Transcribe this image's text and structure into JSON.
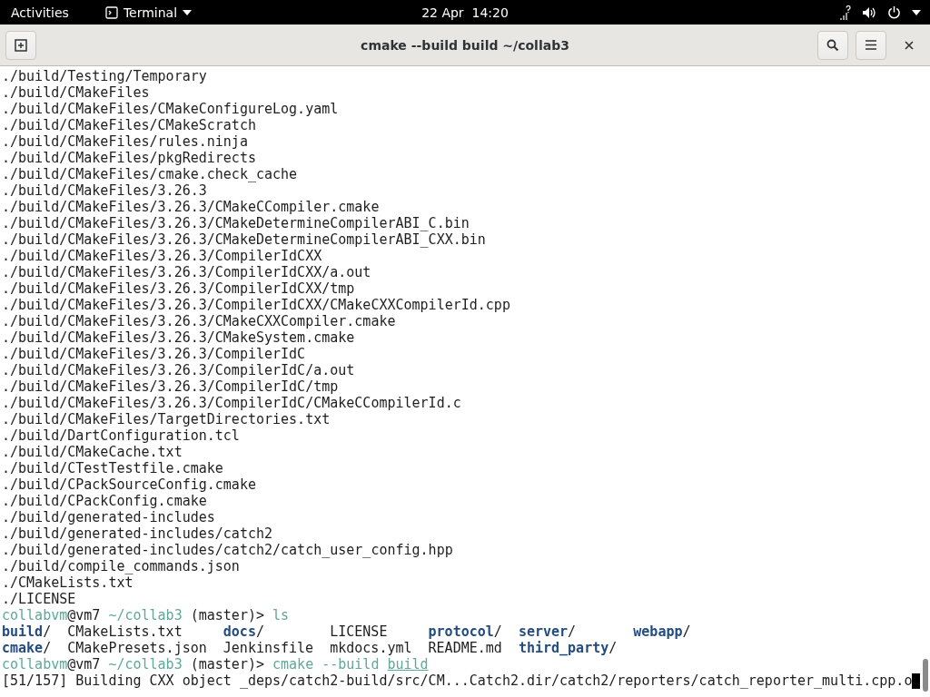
{
  "top_bar": {
    "activities": "Activities",
    "app_menu": "Terminal",
    "clock": "22 Apr  14:20"
  },
  "window": {
    "title": "cmake --build build ~/collab3"
  },
  "terminal": {
    "output": [
      "./build/Testing/Temporary",
      "./build/CMakeFiles",
      "./build/CMakeFiles/CMakeConfigureLog.yaml",
      "./build/CMakeFiles/CMakeScratch",
      "./build/CMakeFiles/rules.ninja",
      "./build/CMakeFiles/pkgRedirects",
      "./build/CMakeFiles/cmake.check_cache",
      "./build/CMakeFiles/3.26.3",
      "./build/CMakeFiles/3.26.3/CMakeCCompiler.cmake",
      "./build/CMakeFiles/3.26.3/CMakeDetermineCompilerABI_C.bin",
      "./build/CMakeFiles/3.26.3/CMakeDetermineCompilerABI_CXX.bin",
      "./build/CMakeFiles/3.26.3/CompilerIdCXX",
      "./build/CMakeFiles/3.26.3/CompilerIdCXX/a.out",
      "./build/CMakeFiles/3.26.3/CompilerIdCXX/tmp",
      "./build/CMakeFiles/3.26.3/CompilerIdCXX/CMakeCXXCompilerId.cpp",
      "./build/CMakeFiles/3.26.3/CMakeCXXCompiler.cmake",
      "./build/CMakeFiles/3.26.3/CMakeSystem.cmake",
      "./build/CMakeFiles/3.26.3/CompilerIdC",
      "./build/CMakeFiles/3.26.3/CompilerIdC/a.out",
      "./build/CMakeFiles/3.26.3/CompilerIdC/tmp",
      "./build/CMakeFiles/3.26.3/CompilerIdC/CMakeCCompilerId.c",
      "./build/CMakeFiles/TargetDirectories.txt",
      "./build/DartConfiguration.tcl",
      "./build/CMakeCache.txt",
      "./build/CTestTestfile.cmake",
      "./build/CPackSourceConfig.cmake",
      "./build/CPackConfig.cmake",
      "./build/generated-includes",
      "./build/generated-includes/catch2",
      "./build/generated-includes/catch2/catch_user_config.hpp",
      "./build/compile_commands.json",
      "./CMakeLists.txt",
      "./LICENSE"
    ],
    "prompt_1": {
      "user": "collabvm",
      "host": "@vm7",
      "cwd": "~/collab3",
      "branch": "(master)>",
      "command": [
        {
          "text": "ls",
          "kind": "cmd"
        }
      ]
    },
    "listing": [
      {
        "name": "build",
        "suffix": "/",
        "kind": "dir"
      },
      {
        "name": "CMakeLists.txt",
        "kind": "file"
      },
      {
        "name": "docs",
        "suffix": "/",
        "kind": "dir"
      },
      {
        "name": "LICENSE",
        "kind": "file"
      },
      {
        "name": "protocol",
        "suffix": "/",
        "kind": "dir"
      },
      {
        "name": "server",
        "suffix": "/",
        "kind": "dir"
      },
      {
        "name": "webapp",
        "suffix": "/",
        "kind": "dir"
      },
      {
        "name": "cmake",
        "suffix": "/",
        "kind": "dir"
      },
      {
        "name": "CMakePresets.json",
        "kind": "file"
      },
      {
        "name": "Jenkinsfile",
        "kind": "file"
      },
      {
        "name": "mkdocs.yml",
        "kind": "file"
      },
      {
        "name": "README.md",
        "kind": "file"
      },
      {
        "name": "third_party",
        "suffix": "/",
        "kind": "dir"
      }
    ],
    "prompt_2": {
      "user": "collabvm",
      "host": "@vm7",
      "cwd": "~/collab3",
      "branch": "(master)>",
      "command": [
        {
          "text": "cmake --build",
          "kind": "cmd"
        },
        {
          "text": "build",
          "kind": "path"
        }
      ]
    },
    "progress_line": "[51/157] Building CXX object _deps/catch2-build/src/CM...Catch2.dir/catch2/reporters/catch_reporter_multi.cpp.o"
  }
}
